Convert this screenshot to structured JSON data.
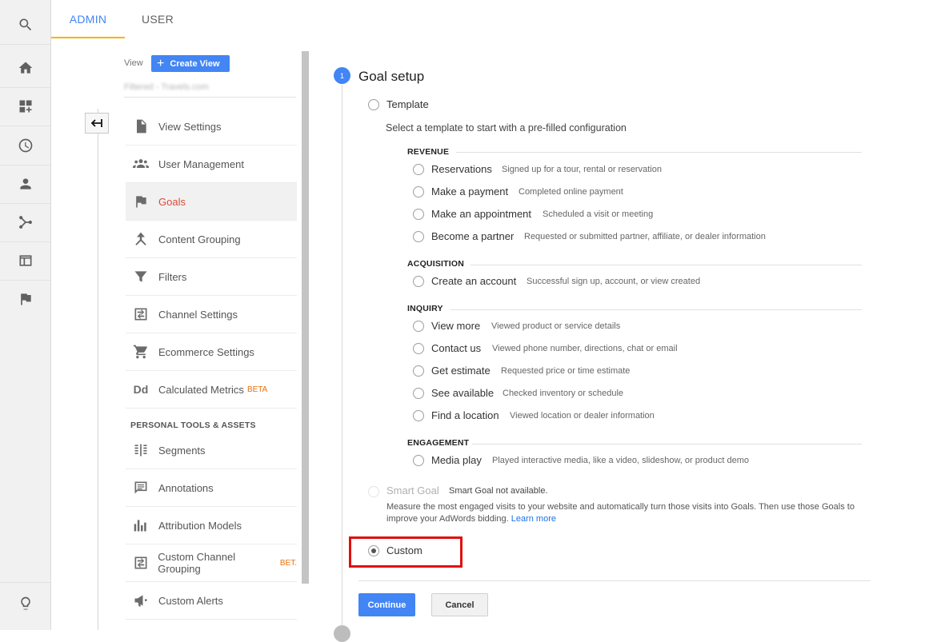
{
  "tabs": {
    "admin": "ADMIN",
    "user": "USER"
  },
  "rail": {
    "items": [
      "search-icon",
      "home-icon",
      "dashboard-icon",
      "clock-icon",
      "person-icon",
      "share-icon",
      "browser-icon",
      "flag-icon",
      "lightbulb-icon"
    ]
  },
  "view": {
    "label": "View",
    "create_button": "Create View",
    "selected_view_blurred": "Filtered - Travels.com"
  },
  "menu": {
    "items": [
      {
        "label": "View Settings",
        "icon": "document-icon"
      },
      {
        "label": "User Management",
        "icon": "people-icon"
      },
      {
        "label": "Goals",
        "icon": "flag-icon",
        "active": true
      },
      {
        "label": "Content Grouping",
        "icon": "merge-icon"
      },
      {
        "label": "Filters",
        "icon": "filter-icon"
      },
      {
        "label": "Channel Settings",
        "icon": "channel-icon"
      },
      {
        "label": "Ecommerce Settings",
        "icon": "cart-icon"
      },
      {
        "label": "Calculated Metrics",
        "icon": "dd-icon",
        "badge": "BETA"
      }
    ],
    "section_heading": "PERSONAL TOOLS & ASSETS",
    "tools": [
      {
        "label": "Segments",
        "icon": "segments-icon"
      },
      {
        "label": "Annotations",
        "icon": "annotation-icon"
      },
      {
        "label": "Attribution Models",
        "icon": "bar-chart-icon"
      },
      {
        "label": "Custom Channel Grouping",
        "icon": "channel-icon",
        "badge": "BET."
      },
      {
        "label": "Custom Alerts",
        "icon": "megaphone-icon"
      }
    ]
  },
  "goal_setup": {
    "step_number": "1",
    "title": "Goal setup",
    "template_label": "Template",
    "template_description": "Select a template to start with a pre-filled configuration",
    "categories": [
      {
        "name": "REVENUE",
        "options": [
          {
            "label": "Reservations",
            "desc": "Signed up for a tour, rental or reservation"
          },
          {
            "label": "Make a payment",
            "desc": "Completed online payment"
          },
          {
            "label": "Make an appointment",
            "desc": "Scheduled a visit or meeting"
          },
          {
            "label": "Become a partner",
            "desc": "Requested or submitted partner, affiliate, or dealer information"
          }
        ]
      },
      {
        "name": "ACQUISITION",
        "options": [
          {
            "label": "Create an account",
            "desc": "Successful sign up, account, or view created"
          }
        ]
      },
      {
        "name": "INQUIRY",
        "options": [
          {
            "label": "View more",
            "desc": "Viewed product or service details"
          },
          {
            "label": "Contact us",
            "desc": "Viewed phone number, directions, chat or email"
          },
          {
            "label": "Get estimate",
            "desc": "Requested price or time estimate"
          },
          {
            "label": "See available",
            "desc": "Checked inventory or schedule"
          },
          {
            "label": "Find a location",
            "desc": "Viewed location or dealer information"
          }
        ]
      },
      {
        "name": "ENGAGEMENT",
        "options": [
          {
            "label": "Media play",
            "desc": "Played interactive media, like a video, slideshow, or product demo"
          }
        ]
      }
    ],
    "smart_goal": {
      "label": "Smart Goal",
      "status": "Smart Goal not available.",
      "description": "Measure the most engaged visits to your website and automatically turn those visits into Goals. Then use those Goals to improve your AdWords bidding.",
      "link": "Learn more"
    },
    "custom_label": "Custom",
    "selected": "Custom"
  },
  "buttons": {
    "continue": "Continue",
    "cancel": "Cancel"
  },
  "colors": {
    "accent": "#4285f4",
    "active_menu": "#dd4b39",
    "highlight_box": "#e0100d",
    "beta": "#e8710a"
  }
}
